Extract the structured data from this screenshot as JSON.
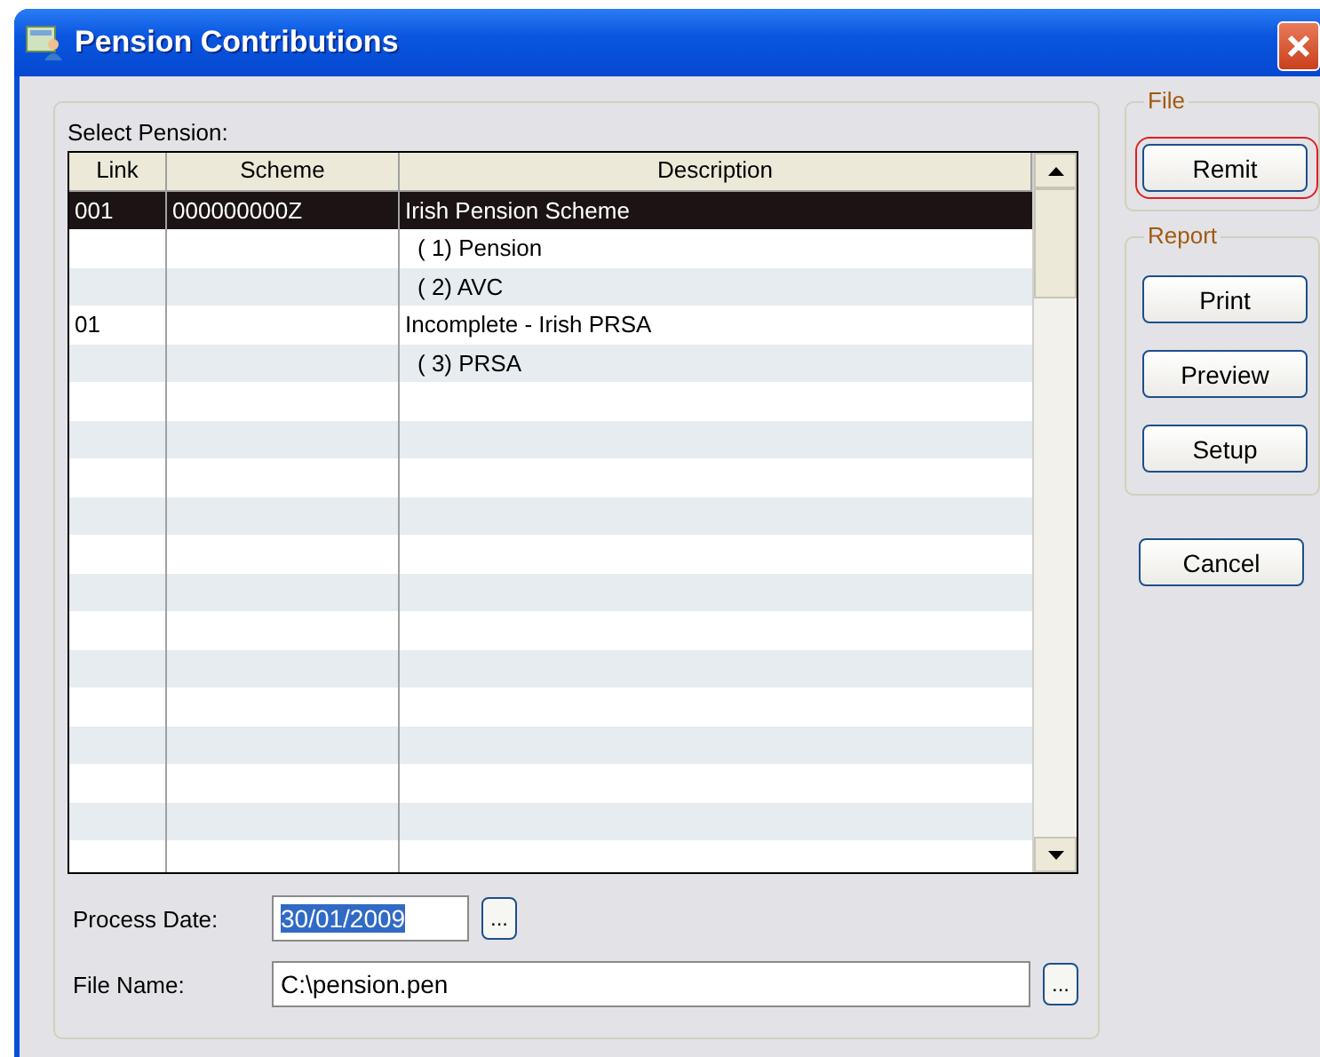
{
  "window": {
    "title": "Pension Contributions"
  },
  "select_label": "Select Pension:",
  "table": {
    "columns": [
      "Link",
      "Scheme",
      "Description"
    ],
    "rows": [
      {
        "link": "001",
        "scheme": "000000000Z",
        "description": "Irish Pension Scheme",
        "child": false,
        "selected": true
      },
      {
        "link": "",
        "scheme": "",
        "description": "( 1) Pension",
        "child": true,
        "selected": false
      },
      {
        "link": "",
        "scheme": "",
        "description": "( 2) AVC",
        "child": true,
        "selected": false
      },
      {
        "link": "01",
        "scheme": "",
        "description": "Incomplete - Irish PRSA",
        "child": false,
        "selected": false
      },
      {
        "link": "",
        "scheme": "",
        "description": "( 3) PRSA",
        "child": true,
        "selected": false
      }
    ]
  },
  "process_date": {
    "label": "Process Date:",
    "value": "30/01/2009",
    "selected": true,
    "browse": "..."
  },
  "file_name": {
    "label": "File Name:",
    "value": "C:\\pension.pen",
    "browse": "..."
  },
  "groups": [
    {
      "title": "File",
      "buttons": [
        {
          "label": "Remit",
          "focused": true
        }
      ]
    },
    {
      "title": "Report",
      "buttons": [
        {
          "label": "Print",
          "focused": false
        },
        {
          "label": "Preview",
          "focused": false
        },
        {
          "label": "Setup",
          "focused": false
        }
      ]
    }
  ],
  "cancel": {
    "label": "Cancel"
  }
}
